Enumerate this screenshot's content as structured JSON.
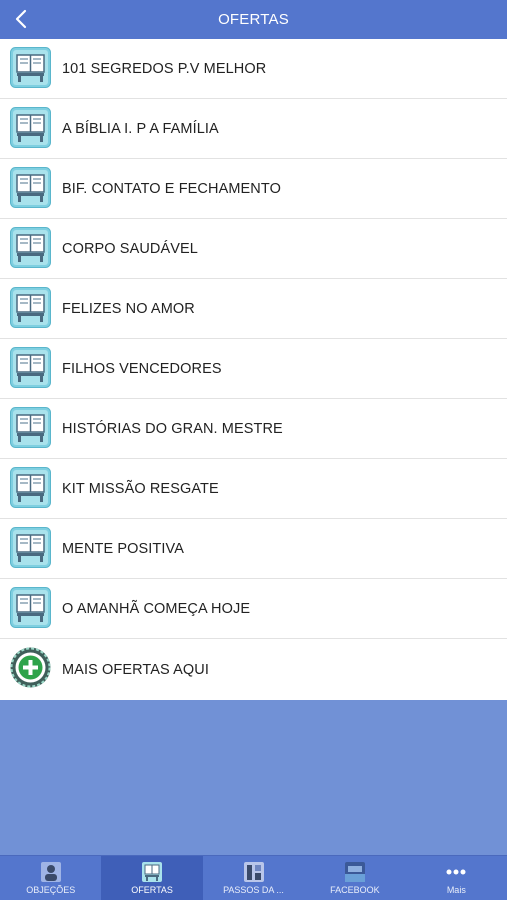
{
  "header": {
    "title": "OFERTAS",
    "back_icon": "chevron-left-icon"
  },
  "list": {
    "items": [
      {
        "label": "101 SEGREDOS P.V MELHOR",
        "icon": "book-stand-icon"
      },
      {
        "label": "A BÍBLIA I. P A FAMÍLIA",
        "icon": "book-stand-icon"
      },
      {
        "label": "BIF. CONTATO E FECHAMENTO",
        "icon": "book-stand-icon"
      },
      {
        "label": "CORPO SAUDÁVEL",
        "icon": "book-stand-icon"
      },
      {
        "label": "FELIZES NO AMOR",
        "icon": "book-stand-icon"
      },
      {
        "label": "FILHOS VENCEDORES",
        "icon": "book-stand-icon"
      },
      {
        "label": "HISTÓRIAS DO GRAN. MESTRE",
        "icon": "book-stand-icon"
      },
      {
        "label": "KIT MISSÃO RESGATE",
        "icon": "book-stand-icon"
      },
      {
        "label": "MENTE POSITIVA",
        "icon": "book-stand-icon"
      },
      {
        "label": "O AMANHÃ COMEÇA HOJE",
        "icon": "book-stand-icon"
      },
      {
        "label": "MAIS OFERTAS AQUI",
        "icon": "add-circle-icon"
      }
    ]
  },
  "tabbar": {
    "tabs": [
      {
        "label": "OBJEÇÕES",
        "icon": "person-icon",
        "active": false
      },
      {
        "label": "OFERTAS",
        "icon": "book-stand-icon",
        "active": true
      },
      {
        "label": "PASSOS DA ...",
        "icon": "steps-icon",
        "active": false
      },
      {
        "label": "FACEBOOK",
        "icon": "facebook-icon",
        "active": false
      },
      {
        "label": "Mais",
        "icon": "more-dots-icon",
        "active": false
      }
    ]
  },
  "colors": {
    "bar": "#5476cd",
    "background": "#7191d6",
    "active_tab": "#3f5fb8"
  }
}
